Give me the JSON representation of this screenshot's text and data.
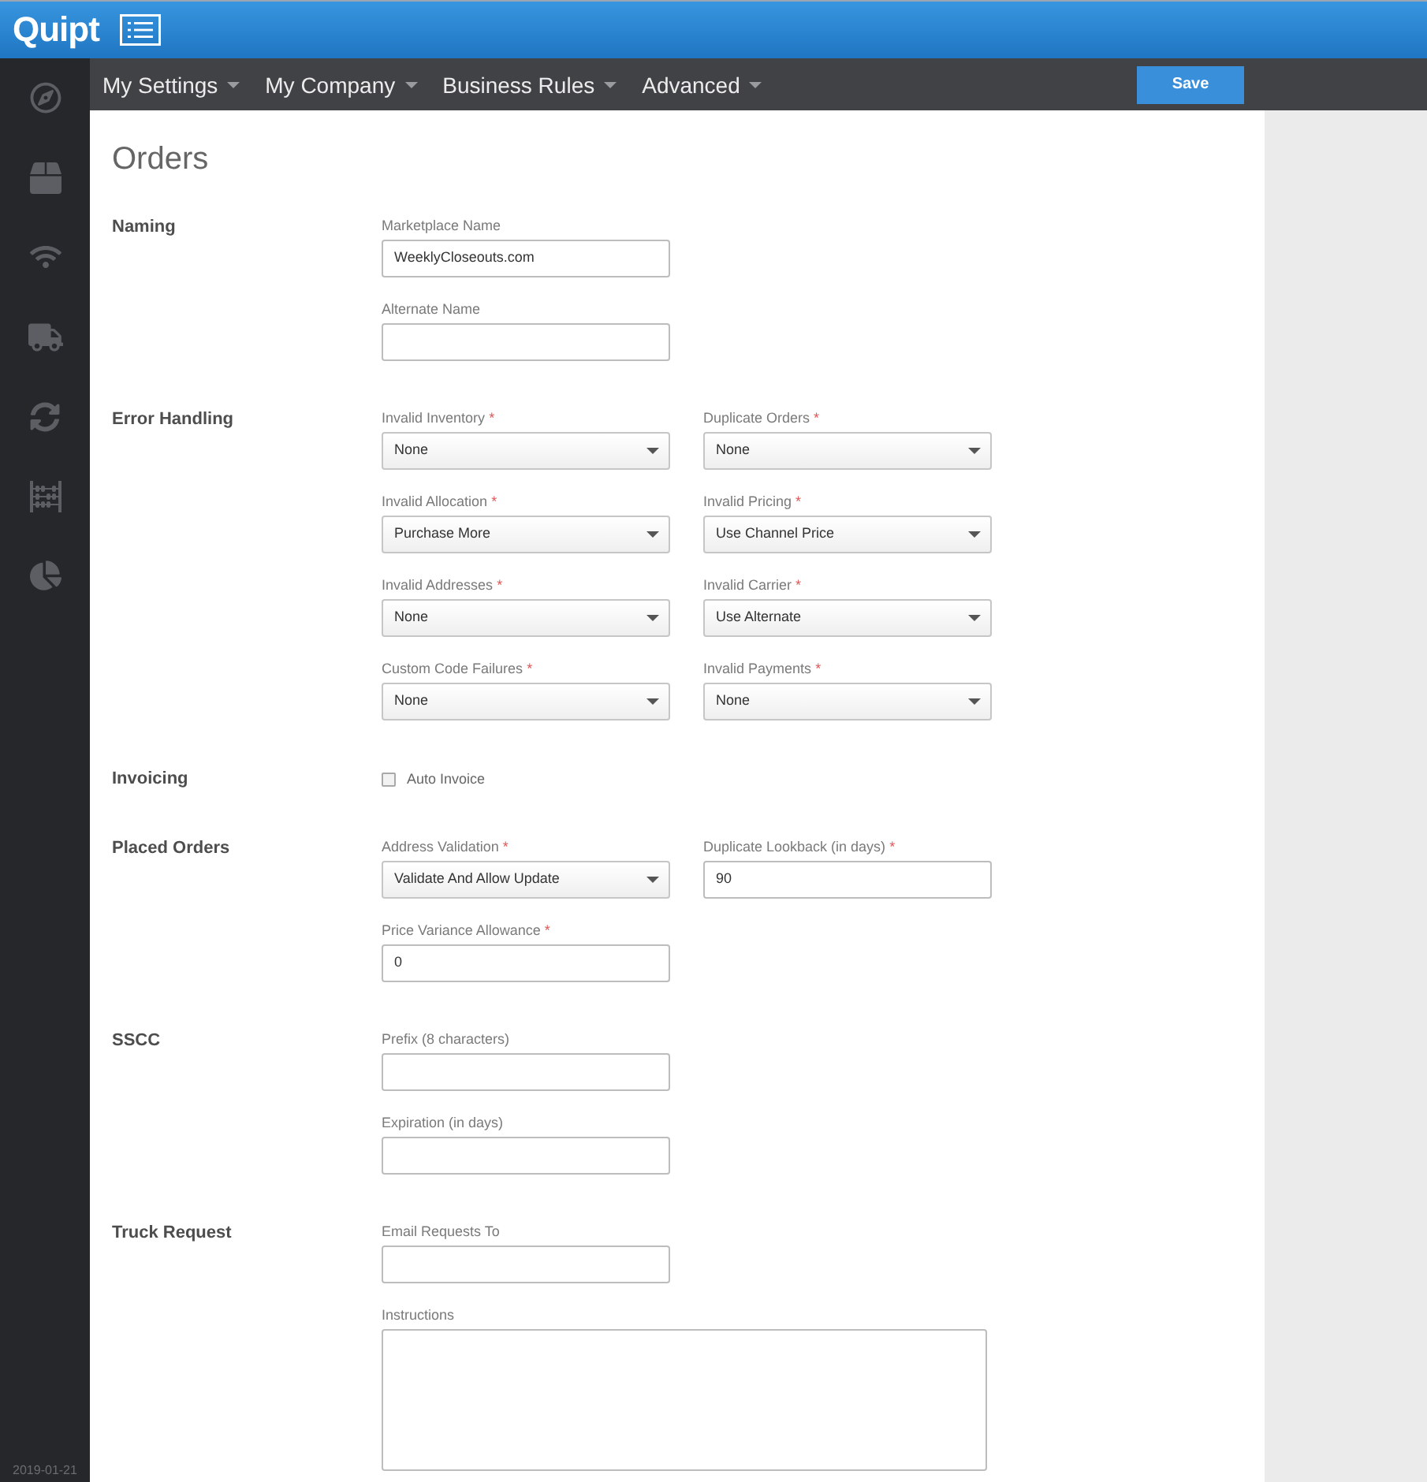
{
  "header": {
    "logo": "Quipt"
  },
  "nav": {
    "menus": [
      {
        "label": "My Settings"
      },
      {
        "label": "My Company"
      },
      {
        "label": "Business Rules"
      },
      {
        "label": "Advanced"
      }
    ],
    "save_button": "Save"
  },
  "sidebar": {
    "date": "2019-01-21"
  },
  "page": {
    "title": "Orders",
    "sections": [
      {
        "title": "Naming",
        "rows": [
          [
            {
              "kind": "text",
              "label": "Marketplace Name",
              "value": "WeeklyCloseouts.com"
            }
          ],
          [
            {
              "kind": "text",
              "label": "Alternate Name"
            }
          ]
        ]
      },
      {
        "title": "Error Handling",
        "rows": [
          [
            {
              "kind": "select",
              "label": "Invalid Inventory",
              "required_mark": "*",
              "value": "None"
            },
            {
              "kind": "select",
              "label": "Duplicate Orders",
              "required_mark": "*",
              "value": "None"
            }
          ],
          [
            {
              "kind": "select",
              "label": "Invalid Allocation",
              "required_mark": "*",
              "value": "Purchase More"
            },
            {
              "kind": "select",
              "label": "Invalid Pricing",
              "required_mark": "*",
              "value": "Use Channel Price"
            }
          ],
          [
            {
              "kind": "select",
              "label": "Invalid Addresses",
              "required_mark": "*",
              "value": "None"
            },
            {
              "kind": "select",
              "label": "Invalid Carrier",
              "required_mark": "*",
              "value": "Use Alternate"
            }
          ],
          [
            {
              "kind": "select",
              "label": "Custom Code Failures",
              "required_mark": "*",
              "value": "None"
            },
            {
              "kind": "select",
              "label": "Invalid Payments",
              "required_mark": "*",
              "value": "None"
            }
          ]
        ]
      },
      {
        "title": "Invoicing",
        "rows": [
          [
            {
              "kind": "checkbox",
              "label": "Auto Invoice",
              "checked": false
            }
          ]
        ]
      },
      {
        "title": "Placed Orders",
        "rows": [
          [
            {
              "kind": "select",
              "label": "Address Validation",
              "required_mark": "*",
              "value": "Validate And Allow Update"
            },
            {
              "kind": "text",
              "label": "Duplicate Lookback (in days)",
              "required_mark": "*",
              "value": "90"
            }
          ],
          [
            {
              "kind": "text",
              "label": "Price Variance Allowance",
              "required_mark": "*",
              "value": "0"
            }
          ]
        ]
      },
      {
        "title": "SSCC",
        "rows": [
          [
            {
              "kind": "text",
              "label": "Prefix (8 characters)"
            }
          ],
          [
            {
              "kind": "text",
              "label": "Expiration (in days)"
            }
          ]
        ]
      },
      {
        "title": "Truck Request",
        "rows": [
          [
            {
              "kind": "text",
              "label": "Email Requests To"
            }
          ],
          [
            {
              "kind": "textarea",
              "label": "Instructions"
            }
          ]
        ]
      }
    ]
  }
}
